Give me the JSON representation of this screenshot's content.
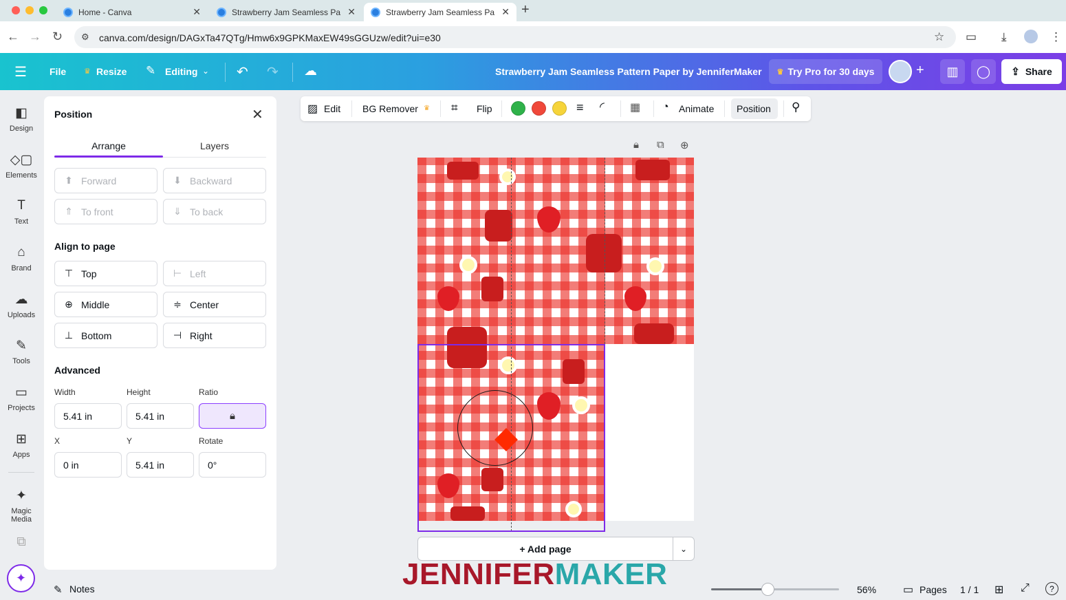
{
  "browser": {
    "tabs": [
      {
        "label": "Home - Canva"
      },
      {
        "label": "Strawberry Jam Seamless Pa"
      },
      {
        "label": "Strawberry Jam Seamless Pa"
      }
    ],
    "new_tab": "+",
    "url": "canva.com/design/DAGxTa47QTg/Hmw6x9GPKMaxEW49sGGUzw/edit?ui=e30"
  },
  "header": {
    "file": "File",
    "resize": "Resize",
    "editing": "Editing",
    "title": "Strawberry Jam Seamless Pattern Paper by JenniferMaker",
    "try_pro": "Try Pro for 30 days",
    "share": "Share"
  },
  "sidebar": {
    "items": [
      {
        "label": "Design",
        "icon": "design-icon"
      },
      {
        "label": "Elements",
        "icon": "elements-icon"
      },
      {
        "label": "Text",
        "icon": "text-icon"
      },
      {
        "label": "Brand",
        "icon": "brand-icon"
      },
      {
        "label": "Uploads",
        "icon": "uploads-icon"
      },
      {
        "label": "Tools",
        "icon": "tools-icon"
      },
      {
        "label": "Projects",
        "icon": "projects-icon"
      },
      {
        "label": "Apps",
        "icon": "apps-icon"
      },
      {
        "label": "Magic Media",
        "icon": "magic-media-icon"
      }
    ]
  },
  "panel": {
    "title": "Position",
    "tabs": [
      "Arrange",
      "Layers"
    ],
    "layer_buttons": [
      "Forward",
      "Backward",
      "To front",
      "To back"
    ],
    "align_heading": "Align to page",
    "align_buttons": [
      "Top",
      "Left",
      "Middle",
      "Center",
      "Bottom",
      "Right"
    ],
    "advanced_heading": "Advanced",
    "width_label": "Width",
    "height_label": "Height",
    "ratio_label": "Ratio",
    "x_label": "X",
    "y_label": "Y",
    "rotate_label": "Rotate",
    "width_value": "5.41 in",
    "height_value": "5.41 in",
    "x_value": "0 in",
    "y_value": "5.41 in",
    "rotate_value": "0°"
  },
  "toolbar": {
    "edit": "Edit",
    "bg_remover": "BG Remover",
    "flip": "Flip",
    "animate": "Animate",
    "position": "Position",
    "colors": [
      "#2fb24a",
      "#f0483a",
      "#f6d43a"
    ]
  },
  "canvas": {
    "add_page": "+ Add page",
    "brand_jennifer": "JENNIFER",
    "brand_maker": "MAKER",
    "brand_colors": {
      "jennifer": "#a8182a",
      "maker": "#2aa7a9"
    }
  },
  "footer": {
    "notes": "Notes",
    "zoom": "56%",
    "pages": "Pages",
    "page_count": "1 / 1",
    "zoom_level": 0.4
  }
}
